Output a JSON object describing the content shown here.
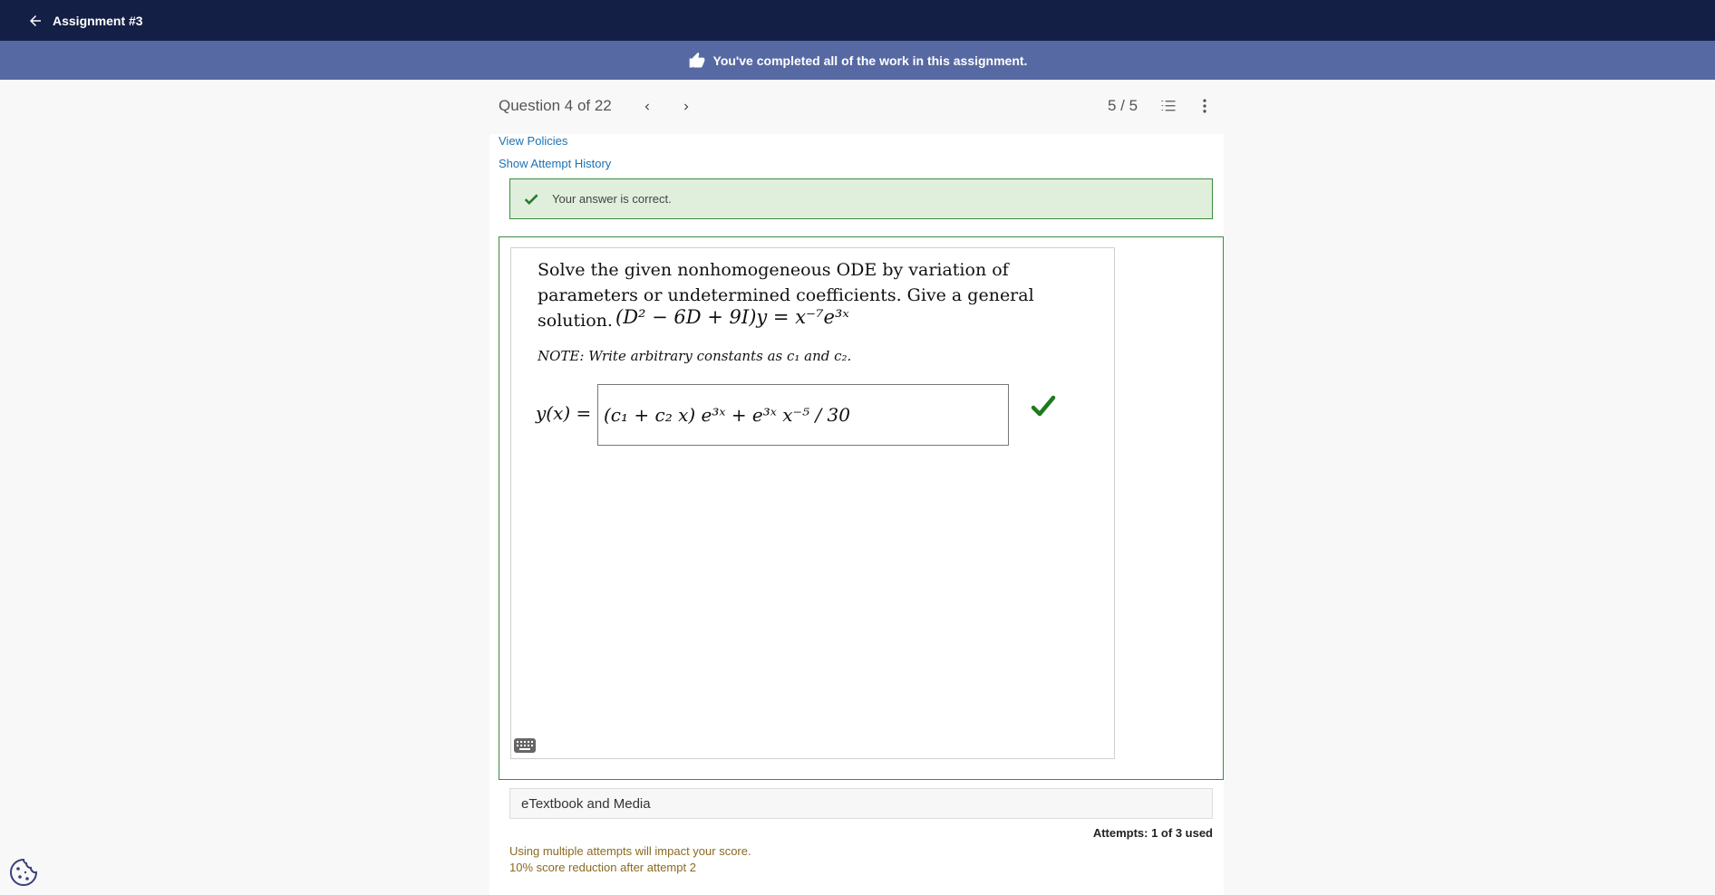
{
  "header": {
    "title": "Assignment #3",
    "back_icon": "arrow-left-icon"
  },
  "banner": {
    "text": "You've completed all of the work in this assignment.",
    "icon": "thumbs-up-icon"
  },
  "question_nav": {
    "title": "Question 4 of 22",
    "score": "5 / 5"
  },
  "links": {
    "view_policies": "View Policies",
    "show_attempt_history": "Show Attempt History"
  },
  "feedback": {
    "text": "Your answer is correct."
  },
  "problem": {
    "statement": "Solve the given nonhomogeneous ODE by variation of parameters or undetermined coefficients. Give a general solution.",
    "equation": "(D² − 6D + 9I)y = x⁻⁷e³ˣ",
    "note": "NOTE: Write arbitrary constants as c₁ and c₂.",
    "answer_label": "y(x) =",
    "answer_value": "(c₁ + c₂ x) e³ˣ + e³ˣ x⁻⁵ / 30"
  },
  "etextbook": {
    "label": "eTextbook and Media"
  },
  "attempts": {
    "used": "Attempts: 1 of 3 used",
    "warning_line1": "Using multiple attempts will impact your score.",
    "warning_line2": "10% score reduction after attempt 2"
  },
  "colors": {
    "topbar": "#141f46",
    "banner": "#5669a3",
    "correct_green": "#3c8c3c",
    "correct_bg": "#dfefdc",
    "link_blue": "#1a73b5",
    "warning_brown": "#8a6a1f"
  }
}
